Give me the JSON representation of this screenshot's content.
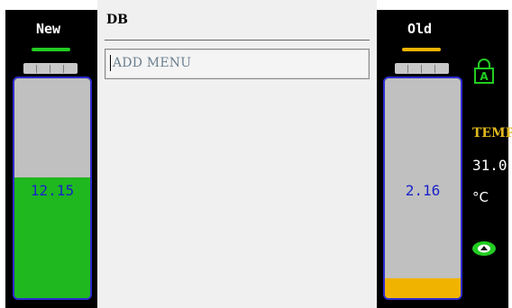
{
  "left_battery": {
    "label": "New",
    "value": "12.15",
    "fill_fraction": 0.55,
    "fill_color": "#1fb81f",
    "underline_color": "#22cc22"
  },
  "right_battery": {
    "label": "Old",
    "value": "2.16",
    "fill_fraction": 0.09,
    "fill_color": "#f0b400",
    "underline_color": "#f0b400"
  },
  "panel": {
    "title": "DB",
    "menu_text": "ADD MENU"
  },
  "right_info": {
    "lock_icon": "lock-a-icon",
    "temp_label": "TEMP",
    "temp_value": "31.0",
    "temp_unit": "°C",
    "status_icon": "eye-icon"
  },
  "colors": {
    "battery_border": "#2c2cd0",
    "value_text": "#1a23c8",
    "temp_label": "#e0b820",
    "icon_green": "#22cc22"
  }
}
